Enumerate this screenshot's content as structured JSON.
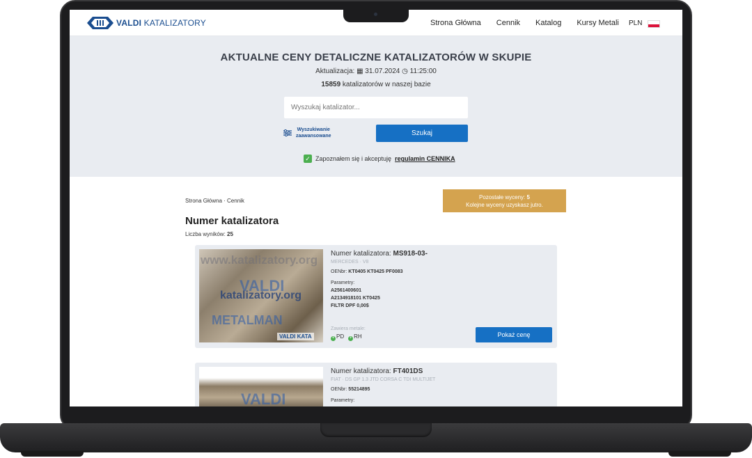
{
  "header": {
    "logo_bold": "VALDI",
    "logo_light": "KATALIZATORY",
    "menu": [
      "Strona Główna",
      "Cennik",
      "Katalog",
      "Kursy Metali"
    ],
    "currency": "PLN"
  },
  "hero": {
    "title": "AKTUALNE CENY DETALICZNE KATALIZATORÓW W SKUPIE",
    "update_label": "Aktualizacja:",
    "update_date": "31.07.2024",
    "update_time": "11:25:00",
    "count": "15859",
    "count_suffix": "katalizatorów w naszej bazie",
    "search_placeholder": "Wyszukaj katalizator...",
    "advanced_line1": "Wyszukiwanie",
    "advanced_line2": "zaawansowane",
    "search_button": "Szukaj",
    "agree_text": "Zapoznałem się i akceptuję",
    "agree_link": "regulamin CENNIKA"
  },
  "content": {
    "breadcrumb": "Strona Główna · Cennik",
    "quota_label": "Pozostałe wyceny:",
    "quota_value": "5",
    "quota_note": "Kolejne wyceny uzyskasz jutro.",
    "page_title": "Numer katalizatora",
    "results_label": "Liczba wyników:",
    "results_value": "25"
  },
  "cards": [
    {
      "name_label": "Numer katalizatora:",
      "name": "MS918-03-",
      "make": "MERCEDES · V8",
      "oem_label": "OENbr:",
      "oem": "KT0405 KT0425 PF0083",
      "param_label": "Parametry:",
      "params": [
        "A2561400601",
        "A2134918101 KT0425",
        "FILTR DPF 0,00$"
      ],
      "metals_label": "Zawiera metale:",
      "metals": [
        "PD",
        "RH"
      ],
      "button": "Pokaż cenę",
      "watermark1": "www.katalizatory.org",
      "watermark2": "VALDI",
      "watermark3": "katalizatory.org",
      "watermark4": "METALMAN",
      "watermark5": "VALDI KATA"
    },
    {
      "name_label": "Numer katalizatora:",
      "name": "FT401DS",
      "make": "FIAT · DS GP 1.3 JTD CORSA C TDI MULTIJET",
      "oem_label": "OENbr:",
      "oem": "55214895",
      "param_label": "Parametry:",
      "watermark2": "VALDI"
    }
  ]
}
